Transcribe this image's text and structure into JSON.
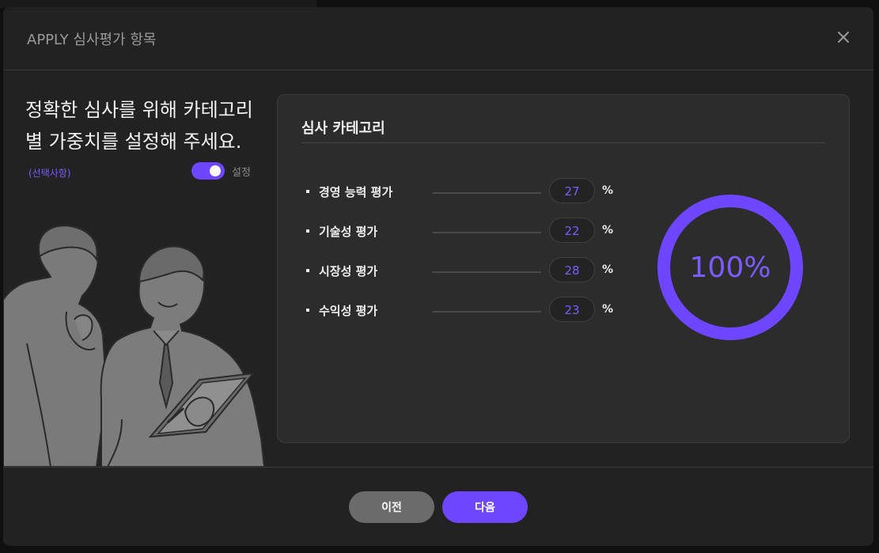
{
  "modal": {
    "title": "APPLY 심사평가 항목",
    "close_icon": "close-icon"
  },
  "intro": {
    "headline": "정확한 심사를 위해 카테고리 별 가중치를 설정해 주세요.",
    "optional_tag": "(선택사항)",
    "toggle_label": "설정",
    "toggle_on": true
  },
  "card": {
    "title": "심사 카테고리",
    "unit": "%",
    "items": [
      {
        "label": "경영 능력 평가",
        "value": "27"
      },
      {
        "label": "기술성 평가",
        "value": "22"
      },
      {
        "label": "시장성 평가",
        "value": "28"
      },
      {
        "label": "수익성 평가",
        "value": "23"
      }
    ],
    "total_label": "100%",
    "total_fraction": 1.0
  },
  "footer": {
    "prev_label": "이전",
    "next_label": "다음"
  },
  "colors": {
    "accent": "#6e46ff",
    "modal_bg": "#222222",
    "card_bg": "#2c2c2c",
    "prev_button": "#6b6b6b"
  }
}
